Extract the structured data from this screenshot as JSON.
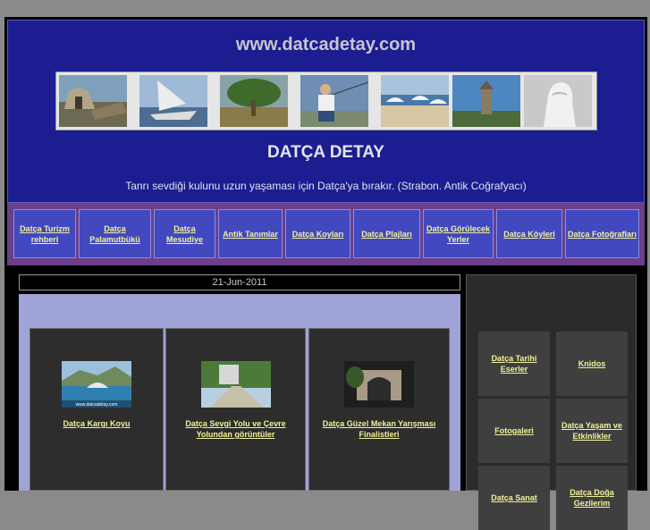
{
  "header": {
    "site_url": "www.datcadetay.com",
    "title": "DATÇA DETAY",
    "quote": "Tanrı sevdiği kulunu uzun yaşaması için Datça'ya bırakır. (Strabon. Antik Coğrafyacı)"
  },
  "photos": [
    {
      "name": "ruins-photo"
    },
    {
      "name": "sailing-photo"
    },
    {
      "name": "olive-tree-photo"
    },
    {
      "name": "fisherman-photo"
    },
    {
      "name": "beach-umbrellas-photo"
    },
    {
      "name": "windmill-photo"
    },
    {
      "name": "statue-photo"
    }
  ],
  "nav": {
    "items": [
      {
        "label": "Datça Turizm rehberi"
      },
      {
        "label": "Datça Palamutbükü"
      },
      {
        "label": "Datça Mesudiye"
      },
      {
        "label": "Antik Tanımlar"
      },
      {
        "label": "Datça Koyları"
      },
      {
        "label": "Datça Plajları"
      },
      {
        "label": "Datça Görülecek Yerler"
      },
      {
        "label": "Datça Köyleri"
      },
      {
        "label": "Datça Fotoğrafları"
      }
    ]
  },
  "main": {
    "date": "21-Jun-2011",
    "cards": [
      {
        "label": "Datça Kargı Koyu",
        "image_caption": "www.datcadetay.com"
      },
      {
        "label": "Datça Sevgi Yolu ve Çevre Yolundan görüntüler"
      },
      {
        "label": "Datça Güzel Mekan Yarışması Finalistleri"
      }
    ]
  },
  "sidebar": {
    "items": [
      {
        "label": "Datça Tarihi Eserler"
      },
      {
        "label": "Knidos"
      },
      {
        "label": "Fotogaleri"
      },
      {
        "label": "Datça Yaşam ve Etkinlikler"
      },
      {
        "label": "Datça Sanat"
      },
      {
        "label": "Datça Doğa Gezilerim"
      }
    ]
  }
}
